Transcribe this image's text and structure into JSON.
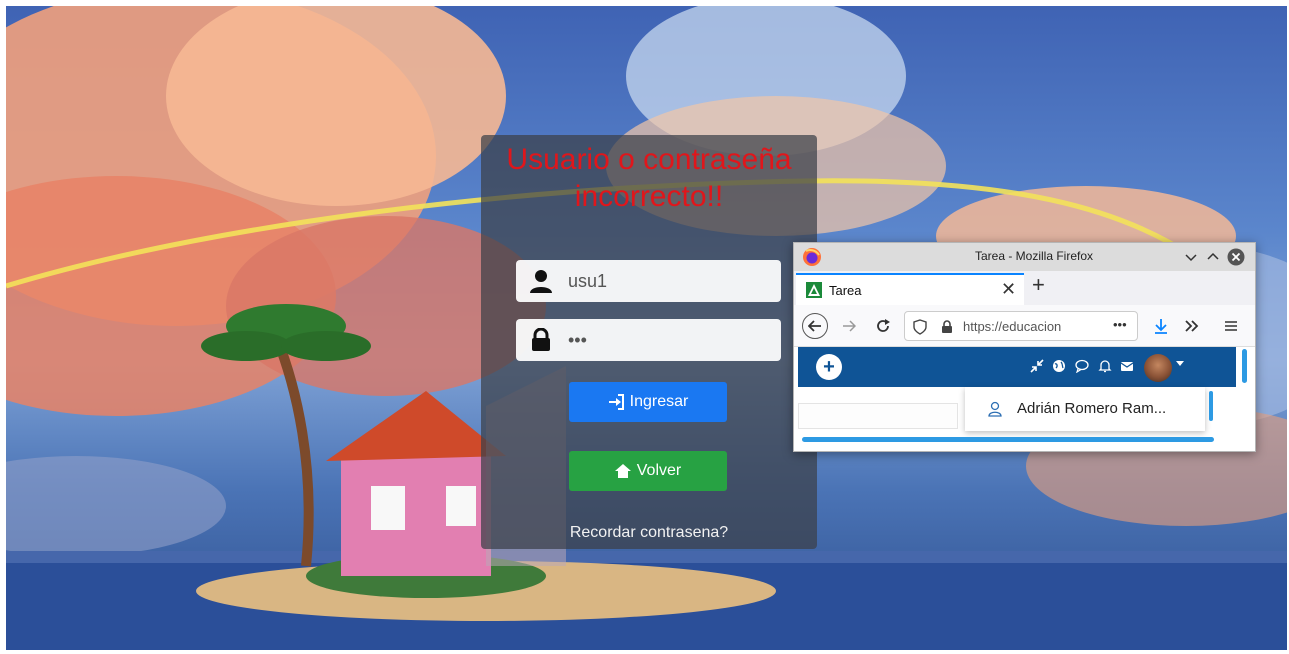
{
  "login": {
    "error_message": "Usuario o contraseña incorrecto!!",
    "username_value": "usu1",
    "password_value": "•••",
    "submit_label": "Ingresar",
    "back_label": "Volver",
    "forgot_label": "Recordar contrasena?",
    "colors": {
      "primary": "#1a78f2",
      "success": "#27a243",
      "error": "#e0161b"
    },
    "icons": [
      "user-icon",
      "lock-icon",
      "sign-in-icon",
      "home-icon"
    ]
  },
  "firefox": {
    "window_title": "Tarea - Mozilla Firefox",
    "tab_label": "Tarea",
    "url": "https://educacion",
    "url_more": "•••",
    "profile_menu_item": "Adrián Romero Ram...",
    "icons": [
      "firefox-logo-icon",
      "minimize-icon",
      "maximize-icon",
      "close-icon",
      "back-icon",
      "forward-icon",
      "reload-icon",
      "shield-icon",
      "lock-icon",
      "download-icon",
      "overflow-icon",
      "menu-icon",
      "plus-icon",
      "collapse-icon",
      "globe-icon",
      "comment-icon",
      "bell-icon",
      "mail-icon",
      "user-icon"
    ],
    "colors": {
      "site_header": "#0f5496",
      "accent": "#2d9ae3"
    }
  }
}
